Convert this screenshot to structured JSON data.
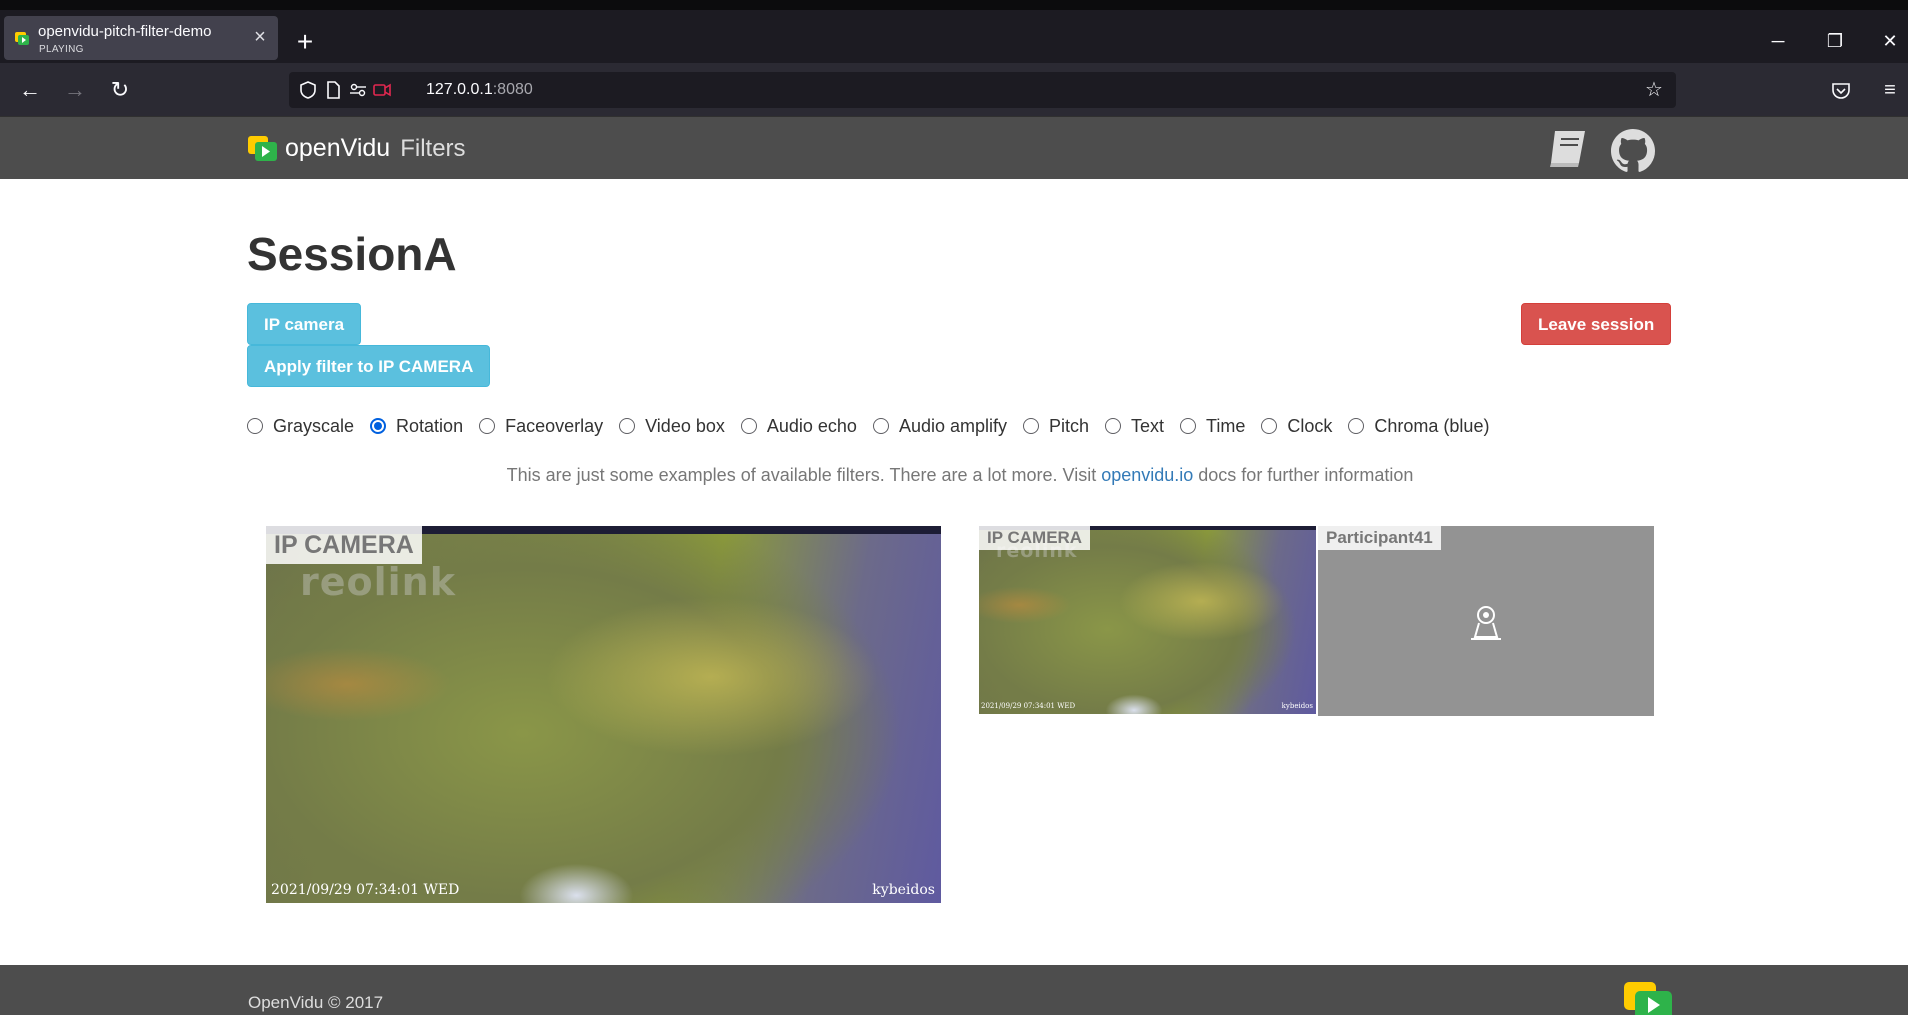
{
  "browser": {
    "tab": {
      "title": "openvidu-pitch-filter-demo",
      "status": "PLAYING"
    },
    "url": {
      "host": "127.0.0.1",
      "port": ":8080"
    },
    "controls": {
      "back": "back-arrow-icon",
      "forward": "forward-arrow-icon",
      "reload": "reload-icon",
      "new_tab": "+",
      "minimize": "─",
      "restore": "❐",
      "close": "✕"
    }
  },
  "app": {
    "brand": "openVidu",
    "section": "Filters"
  },
  "session": {
    "title": "SessionA",
    "ip_camera_button": "IP camera",
    "apply_filter_button": "Apply filter to IP CAMERA",
    "leave_button": "Leave session",
    "filters": [
      {
        "label": "Grayscale",
        "checked": false
      },
      {
        "label": "Rotation",
        "checked": true
      },
      {
        "label": "Faceoverlay",
        "checked": false
      },
      {
        "label": "Video box",
        "checked": false
      },
      {
        "label": "Audio echo",
        "checked": false
      },
      {
        "label": "Audio amplify",
        "checked": false
      },
      {
        "label": "Pitch",
        "checked": false
      },
      {
        "label": "Text",
        "checked": false
      },
      {
        "label": "Time",
        "checked": false
      },
      {
        "label": "Clock",
        "checked": false
      },
      {
        "label": "Chroma (blue)",
        "checked": false
      }
    ],
    "info_prefix": "This are just some examples of available filters. There are a lot more. Visit ",
    "info_link": "openvidu.io",
    "info_suffix": " docs for further information"
  },
  "videos": {
    "main": {
      "label": "IP CAMERA",
      "watermark": "reolink",
      "timestamp": "2021/09/29 07:34:01 WED",
      "owner": "kybeidos"
    },
    "thumb": {
      "label": "IP CAMERA",
      "watermark": "reolink",
      "timestamp": "2021/09/29 07:34:01 WED",
      "owner": "kybeidos"
    },
    "participant": {
      "label": "Participant41"
    }
  },
  "footer": {
    "text": "OpenVidu © 2017"
  },
  "colors": {
    "primary_button": "#5bc0de",
    "danger_button": "#d9534f",
    "navbar": "#4d4d4d",
    "radio_checked": "#0060df",
    "link": "#337ab7"
  }
}
